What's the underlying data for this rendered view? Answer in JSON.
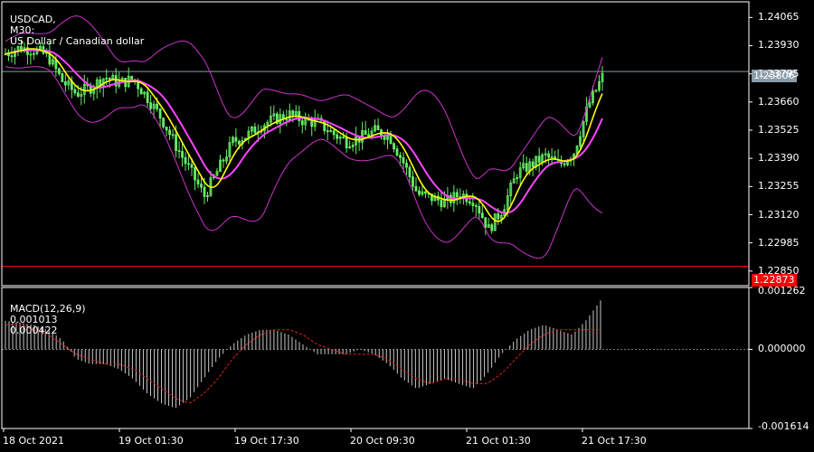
{
  "chart_title": {
    "symbol": "USDCAD",
    "timeframe": "M30",
    "description": "US Dollar / Canadian dollar"
  },
  "macd_label": {
    "name": "MACD(12,26,9)",
    "main": "0.001013",
    "signal": "0.000422"
  },
  "price_badges": {
    "bid": "1.23806",
    "low_line": "1.22873"
  },
  "colors": {
    "background": "#000000",
    "bull_candle": "#66ee66",
    "bollinger": "#cc33cc",
    "ma_fast": "#ffff00",
    "ma_slow": "#ff44ff",
    "macd_hist": "#c8c8c8",
    "macd_signal": "#dd2222",
    "bid_line": "#8a9aa8",
    "low_line": "#ff0000"
  },
  "chart_data": [
    {
      "type": "candlestick",
      "title": "USDCAD, M30:  US Dollar / Canadian dollar",
      "ylim": [
        1.2278,
        1.2414
      ],
      "y_ticks": [
        "1.24065",
        "1.23930",
        "1.23795",
        "1.23660",
        "1.23525",
        "1.23390",
        "1.23255",
        "1.23120",
        "1.22985",
        "1.22850"
      ],
      "x_ticks": [
        "18 Oct 2021",
        "19 Oct 01:30",
        "19 Oct 17:30",
        "20 Oct 09:30",
        "21 Oct 01:30",
        "21 Oct 17:30"
      ],
      "close": [
        1.2389,
        1.2392,
        1.2391,
        1.2388,
        1.2376,
        1.237,
        1.2373,
        1.2378,
        1.2375,
        1.2377,
        1.2368,
        1.2358,
        1.2345,
        1.2333,
        1.2321,
        1.2334,
        1.2347,
        1.235,
        1.2355,
        1.2358,
        1.236,
        1.2357,
        1.2356,
        1.2351,
        1.2347,
        1.2349,
        1.2352,
        1.235,
        1.2337,
        1.2322,
        1.232,
        1.2318,
        1.2322,
        1.2319,
        1.2305,
        1.2315,
        1.2332,
        1.2336,
        1.234,
        1.2336,
        1.2342,
        1.2364,
        1.2378
      ],
      "bid_line": 1.23806,
      "low_line": 1.22873
    },
    {
      "type": "bar",
      "title": "MACD(12,26,9) 0.001013 0.000422",
      "ylim": [
        -0.001614,
        0.001262
      ],
      "y_ticks": [
        "0.001262",
        "0.000000",
        "-0.001614"
      ],
      "values": [
        0.00058,
        0.00055,
        0.0005,
        0.0004,
        0.0002,
        -0.0002,
        -0.0003,
        -0.0003,
        -0.0004,
        -0.0006,
        -0.0009,
        -0.0011,
        -0.0012,
        -0.001,
        -0.0006,
        -0.0002,
        0.0001,
        0.0003,
        0.0004,
        0.0004,
        0.0003,
        0.0001,
        -0.0001,
        -0.0001,
        -0.0001,
        0.0,
        -0.0001,
        -0.0003,
        -0.0006,
        -0.0008,
        -0.0007,
        -0.0006,
        -0.0007,
        -0.0008,
        -0.0005,
        -0.0001,
        0.0002,
        0.0004,
        0.0005,
        0.0004,
        0.0003,
        0.0006,
        0.001
      ],
      "signal": [
        0.0005,
        0.0005,
        0.0004,
        0.0003,
        0.0001,
        -0.0001,
        -0.0002,
        -0.0003,
        -0.0003,
        -0.0004,
        -0.0006,
        -0.0008,
        -0.001,
        -0.0011,
        -0.0009,
        -0.0006,
        -0.0002,
        0.0001,
        0.0003,
        0.0004,
        0.0004,
        0.0003,
        0.0001,
        -0.0,
        -0.0001,
        -0.0001,
        -0.0001,
        -0.0002,
        -0.0004,
        -0.0006,
        -0.0007,
        -0.0006,
        -0.0006,
        -0.0007,
        -0.0007,
        -0.0005,
        -0.0002,
        0.0001,
        0.0003,
        0.0004,
        0.0004,
        0.0004,
        0.0004
      ]
    }
  ]
}
